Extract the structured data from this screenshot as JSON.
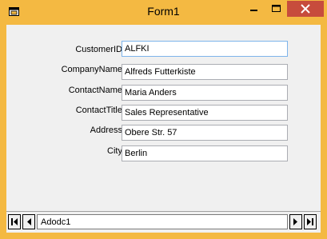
{
  "window": {
    "title": "Form1",
    "titlebar_color": "#f4b942",
    "close_color": "#c74c3c"
  },
  "form": {
    "fields": [
      {
        "label": "CustomerID",
        "value": "ALFKI"
      },
      {
        "label": "CompanyName",
        "value": "Alfreds Futterkiste"
      },
      {
        "label": "ContactName",
        "value": "Maria Anders"
      },
      {
        "label": "ContactTitle",
        "value": "Sales Representative"
      },
      {
        "label": "Address",
        "value": "Obere Str. 57"
      },
      {
        "label": "City",
        "value": "Berlin"
      }
    ]
  },
  "adodc": {
    "caption": "Adodc1",
    "buttons": [
      "first-record-icon",
      "previous-record-icon",
      "next-record-icon",
      "last-record-icon"
    ]
  }
}
